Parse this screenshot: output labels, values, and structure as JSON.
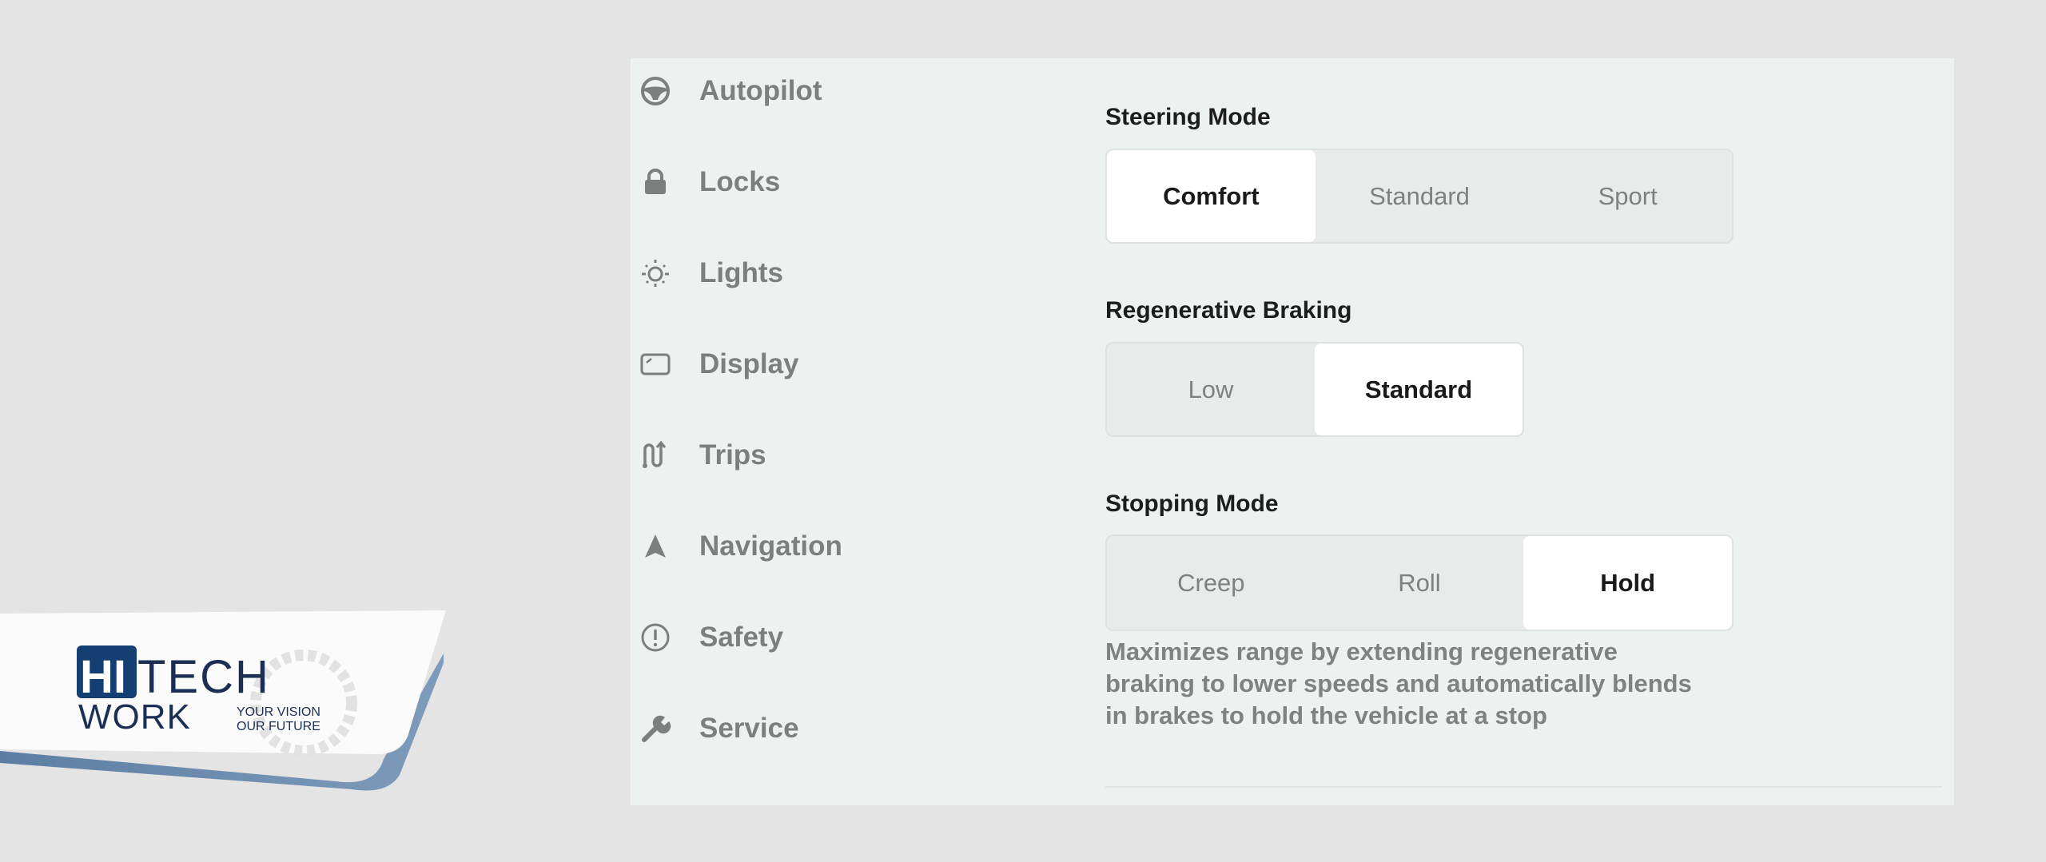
{
  "sidebar": {
    "items": [
      {
        "label": "Autopilot",
        "icon": "steering-wheel-icon"
      },
      {
        "label": "Locks",
        "icon": "lock-icon"
      },
      {
        "label": "Lights",
        "icon": "light-bulb-icon"
      },
      {
        "label": "Display",
        "icon": "display-icon"
      },
      {
        "label": "Trips",
        "icon": "trips-icon"
      },
      {
        "label": "Navigation",
        "icon": "navigation-arrow-icon"
      },
      {
        "label": "Safety",
        "icon": "alert-circle-icon"
      },
      {
        "label": "Service",
        "icon": "wrench-icon"
      }
    ]
  },
  "main": {
    "steering": {
      "title": "Steering Mode",
      "options": [
        "Comfort",
        "Standard",
        "Sport"
      ],
      "selected": "Comfort"
    },
    "regen": {
      "title": "Regenerative Braking",
      "options": [
        "Low",
        "Standard"
      ],
      "selected": "Standard"
    },
    "stopping": {
      "title": "Stopping Mode",
      "options": [
        "Creep",
        "Roll",
        "Hold"
      ],
      "selected": "Hold"
    },
    "description": "Maximizes range by extending regenerative braking to lower speeds and automatically blends in brakes to hold the vehicle at a stop"
  },
  "watermark": {
    "line1": "HI TECH",
    "line2": "WORK",
    "tagline1": "YOUR VISION",
    "tagline2": "OUR FUTURE",
    "brand_color": "#143f73"
  }
}
